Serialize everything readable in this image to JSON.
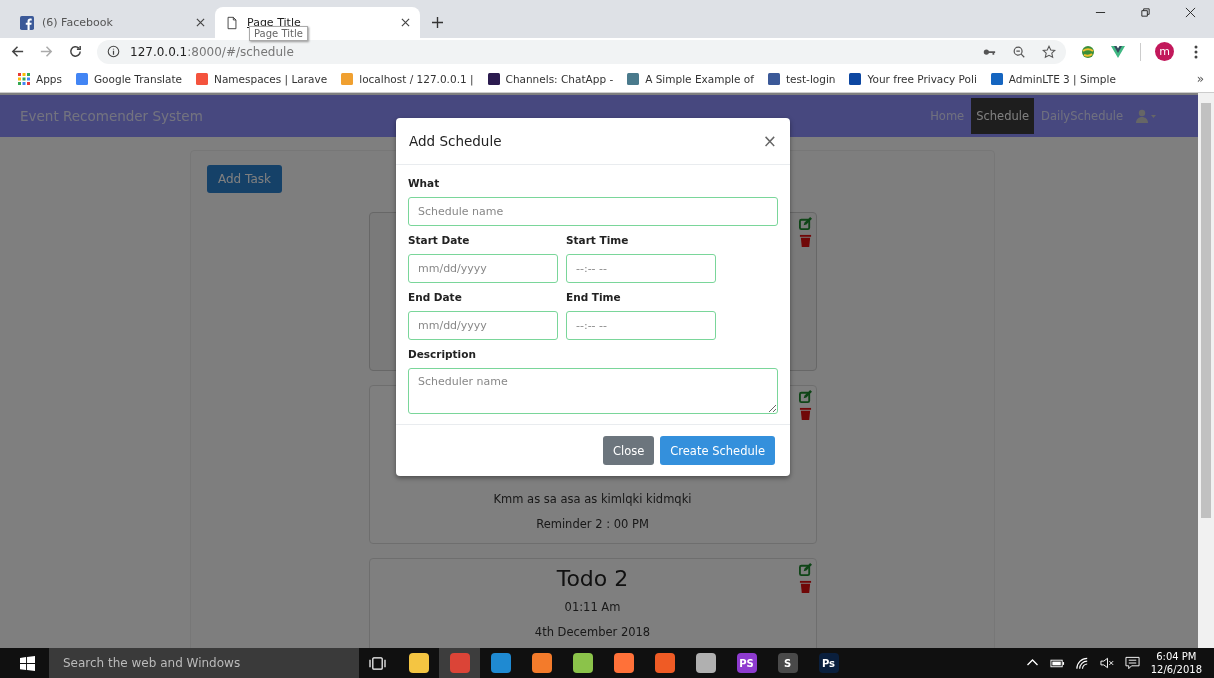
{
  "browser": {
    "tabs": [
      {
        "title": "(6) Facebook",
        "selected": false,
        "kind": "facebook"
      },
      {
        "title": "Page Title",
        "selected": true,
        "kind": "page"
      }
    ],
    "tooltip": "Page Title",
    "address": {
      "host": "127.0.0.1",
      "path": ":8000/#/schedule"
    },
    "profile_initial": "m",
    "bookmarks": [
      {
        "label": "Apps",
        "kind": "apps",
        "color": "#e53935"
      },
      {
        "label": "Google Translate",
        "kind": "site",
        "color": "#4285f4"
      },
      {
        "label": "Namespaces | Larave",
        "kind": "site",
        "color": "#f4533d"
      },
      {
        "label": "localhost / 127.0.0.1 |",
        "kind": "site",
        "color": "#f0a030"
      },
      {
        "label": "Channels: ChatApp -",
        "kind": "site",
        "color": "#2b1b4f"
      },
      {
        "label": "A Simple Example of",
        "kind": "site",
        "color": "#4a7a8c"
      },
      {
        "label": "test-login",
        "kind": "site",
        "color": "#3b5998"
      },
      {
        "label": "Your free Privacy Poli",
        "kind": "site",
        "color": "#0d47a1"
      },
      {
        "label": "AdminLTE 3 | Simple",
        "kind": "site",
        "color": "#1565c0"
      }
    ],
    "more": "»"
  },
  "app": {
    "brand": "Event Recomender System",
    "nav": [
      {
        "label": "Home",
        "selected": false
      },
      {
        "label": "Schedule",
        "selected": true
      },
      {
        "label": "DailySchedule",
        "selected": false
      }
    ],
    "add_task": "Add Task",
    "cards": [
      {
        "kind": "covered"
      },
      {
        "kind": "todo",
        "lines": [
          "Kmm as sa asa as kimlqki kidmqki",
          "Reminder 2 : 00 PM"
        ]
      },
      {
        "kind": "todo",
        "title": "Todo 2",
        "lines": [
          "01:11 Am",
          "4th December 2018"
        ]
      }
    ]
  },
  "modal": {
    "title": "Add Schedule",
    "close": "×",
    "what": {
      "label": "What",
      "placeholder": "Schedule name"
    },
    "start_date": {
      "label": "Start Date",
      "placeholder": "mm/dd/yyyy"
    },
    "start_time": {
      "label": "Start Time",
      "placeholder": "--:-- --"
    },
    "end_date": {
      "label": "End Date",
      "placeholder": "mm/dd/yyyy"
    },
    "end_time": {
      "label": "End Time",
      "placeholder": "--:-- --"
    },
    "description": {
      "label": "Description",
      "placeholder": "Scheduler name"
    },
    "buttons": {
      "close": "Close",
      "create": "Create Schedule"
    }
  },
  "taskbar": {
    "search": "Search the web and Windows",
    "apps": [
      {
        "color": "#f4c542",
        "selected": false
      },
      {
        "color": "#db4437",
        "selected": true
      },
      {
        "color": "#1f8ad2",
        "selected": false
      },
      {
        "color": "#f37b2b",
        "selected": false
      },
      {
        "color": "#8bc34a",
        "selected": false
      },
      {
        "color": "#ff7139",
        "selected": false
      },
      {
        "color": "#ef5b25",
        "selected": false
      },
      {
        "color": "#b0b0b0",
        "selected": false
      },
      {
        "color": "#8e3bcf",
        "label": "PS",
        "selected": false
      },
      {
        "color": "#4a4a4a",
        "label": "S",
        "selected": false
      },
      {
        "color": "#0a1f3d",
        "label": "Ps",
        "selected": false
      }
    ],
    "time": "6:04 PM",
    "date": "12/6/2018"
  }
}
